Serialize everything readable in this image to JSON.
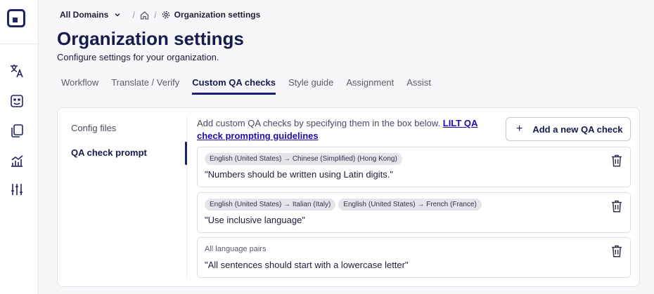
{
  "breadcrumb": {
    "domain": "All Domains",
    "current": "Organization settings",
    "separator": "/"
  },
  "page": {
    "title": "Organization settings",
    "subtitle": "Configure settings for your organization."
  },
  "tabs": [
    {
      "label": "Workflow",
      "active": false
    },
    {
      "label": "Translate / Verify",
      "active": false
    },
    {
      "label": "Custom QA checks",
      "active": true
    },
    {
      "label": "Style guide",
      "active": false
    },
    {
      "label": "Assignment",
      "active": false
    },
    {
      "label": "Assist",
      "active": false
    }
  ],
  "side_nav": [
    {
      "label": "Config files",
      "active": false
    },
    {
      "label": "QA check prompt",
      "active": true
    }
  ],
  "intro": {
    "text": "Add custom QA checks by specifying them in the box below. ",
    "link": "LILT QA check prompting guidelines"
  },
  "add_button": {
    "label": "Add a new QA check",
    "icon": "plus-icon"
  },
  "qa_checks": [
    {
      "tags": [
        "English (United States) → Chinese (Simplified) (Hong Kong)"
      ],
      "prompt": "\"Numbers should be written using Latin digits.\""
    },
    {
      "tags": [
        "English (United States) → Italian (Italy)",
        "English (United States) → French (France)"
      ],
      "prompt": "\"Use inclusive language\""
    },
    {
      "scope": "All language pairs",
      "prompt": "\"All sentences should start with a lowercase letter\""
    }
  ],
  "rail_icons": [
    "logo-icon",
    "translate-icon",
    "review-icon",
    "documents-icon",
    "analytics-icon",
    "settings-sliders-icon"
  ],
  "colors": {
    "brand": "#141b4d",
    "accent": "#1a1f7a",
    "link": "#1a0dab",
    "tag_bg": "#e4e4ea"
  }
}
